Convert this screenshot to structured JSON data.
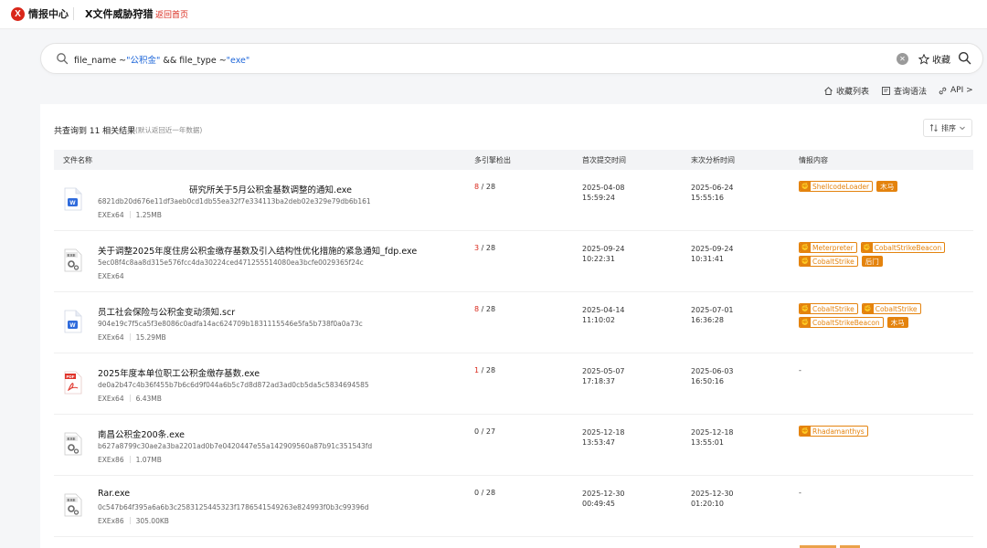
{
  "header": {
    "brand": "情报中心",
    "title": "X文件威胁狩猎",
    "back_link": "返回首页"
  },
  "search": {
    "query_parts": [
      {
        "text": "file_name ~",
        "kind": "plain"
      },
      {
        "text": "\"公积金\"",
        "kind": "value"
      },
      {
        "text": " && file_type ~",
        "kind": "plain"
      },
      {
        "text": "\"exe\"",
        "kind": "value"
      }
    ],
    "favorite_label": "收藏"
  },
  "toolbar": {
    "favorites_list": "收藏列表",
    "query_syntax": "查询语法",
    "api": "API >"
  },
  "results": {
    "count_text": "共查询到 11 相关结果",
    "note": "(默认返回近一年数据)",
    "sort_label": "排序"
  },
  "columns": {
    "file_name": "文件名称",
    "engines": "多引擎检出",
    "first_submit": "首次提交时间",
    "last_analysis": "末次分析时间",
    "intel": "情报内容"
  },
  "rows": [
    {
      "icon": "word",
      "name": "研究所关于5月公积金基数调整的通知.exe",
      "hash": "6821db20d676e11df3aeb0cd1db55ea32f7e334113ba2deb02e329e79db6b161",
      "arch": "EXEx64",
      "size": "1.25MB",
      "hits": "8",
      "total": "/ 28",
      "first_date": "2025-04-08",
      "first_time": "15:59:24",
      "last_date": "2025-06-24",
      "last_time": "15:55:16",
      "tags": [
        {
          "label": "ShellcodeLoader",
          "style": "outline"
        },
        {
          "label": "木马",
          "style": "solid"
        }
      ]
    },
    {
      "icon": "exe",
      "name": "关于调整2025年度住房公积金缴存基数及引入结构性优化措施的紧急通知_fdp.exe",
      "hash": "5ec08f4c8aa8d315e576fcc4da30224ced471255514080ea3bcfe0029365f24c",
      "arch": "EXEx64",
      "size": "",
      "hits": "3",
      "total": "/ 28",
      "first_date": "2025-09-24",
      "first_time": "10:22:31",
      "last_date": "2025-09-24",
      "last_time": "10:31:41",
      "tags": [
        {
          "label": "Meterpreter",
          "style": "outline"
        },
        {
          "label": "CobaltStrikeBeacon",
          "style": "outline"
        },
        {
          "label": "CobaltStrike",
          "style": "outline"
        },
        {
          "label": "后门",
          "style": "solid"
        }
      ]
    },
    {
      "icon": "word",
      "name": "员工社会保险与公积金变动须知.scr",
      "hash": "904e19c7f5ca5f3e8086c0adfa14ac624709b1831115546e5fa5b738f0a0a73c",
      "arch": "EXEx64",
      "size": "15.29MB",
      "hits": "8",
      "total": "/ 28",
      "first_date": "2025-04-14",
      "first_time": "11:10:02",
      "last_date": "2025-07-01",
      "last_time": "16:36:28",
      "tags": [
        {
          "label": "CobaltStrike",
          "style": "outline"
        },
        {
          "label": "CobaltStrike",
          "style": "outline"
        },
        {
          "label": "CobaltStrikeBeacon",
          "style": "outline"
        },
        {
          "label": "木马",
          "style": "solid"
        }
      ]
    },
    {
      "icon": "pdf",
      "name": "2025年度本单位职工公积金缴存基数.exe",
      "hash": "de0a2b47c4b36f455b7b6c6d9f044a6b5c7d8d872ad3ad0cb5da5c5834694585",
      "arch": "EXEx64",
      "size": "6.43MB",
      "hits": "1",
      "total": "/ 28",
      "first_date": "2025-05-07",
      "first_time": "17:18:37",
      "last_date": "2025-06-03",
      "last_time": "16:50:16",
      "intel_empty": "-",
      "tags": []
    },
    {
      "icon": "exe",
      "name": "南昌公积金200条.exe",
      "hash": "b627a8799c30ae2a3ba2201ad0b7e0420447e55a142909560a87b91c351543fd",
      "arch": "EXEx86",
      "size": "1.07MB",
      "hits": "0",
      "total": "/ 27",
      "first_date": "2025-12-18",
      "first_time": "13:53:47",
      "last_date": "2025-12-18",
      "last_time": "13:55:01",
      "tags": [
        {
          "label": "Rhadamanthys",
          "style": "outline"
        }
      ]
    },
    {
      "icon": "exe",
      "name": "Rar.exe",
      "hash": "0c547b64f395a6a6b3c2583125445323f1786541549263e824993f0b3c99396d",
      "arch": "EXEx86",
      "size": "305.00KB",
      "hits": "0",
      "total": "/ 28",
      "first_date": "2025-12-30",
      "first_time": "00:49:45",
      "last_date": "2025-12-30",
      "last_time": "01:20:10",
      "intel_empty": "-",
      "tags": []
    }
  ],
  "colors": {
    "brand_red": "#d9271a",
    "query_blue": "#1e66d9",
    "tag_orange": "#e4830e"
  }
}
